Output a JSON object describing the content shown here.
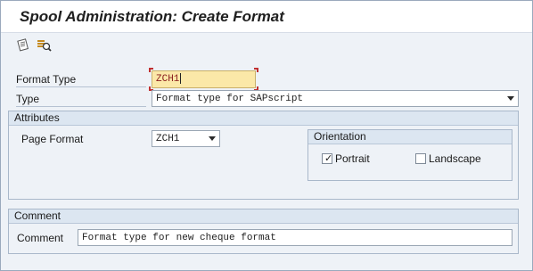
{
  "window": {
    "title": "Spool Administration: Create Format"
  },
  "toolbar": {
    "buttons": [
      {
        "name": "other-object-icon"
      },
      {
        "name": "display-object-icon"
      }
    ]
  },
  "form": {
    "format_type": {
      "label": "Format Type",
      "value": "ZCH1"
    },
    "type": {
      "label": "Type",
      "value": "Format type for SAPscript"
    }
  },
  "attributes": {
    "header": "Attributes",
    "page_format": {
      "label": "Page Format",
      "value": "ZCH1"
    },
    "orientation": {
      "header": "Orientation",
      "portrait": {
        "label": "Portrait",
        "checked": true
      },
      "landscape": {
        "label": "Landscape",
        "checked": false
      }
    }
  },
  "comment": {
    "header": "Comment",
    "label": "Comment",
    "value": "Format type for new cheque format"
  },
  "colors": {
    "required_field_bg": "#fbe8a8",
    "group_header_bg": "#dce6f1",
    "focus_corner": "#c03030"
  }
}
